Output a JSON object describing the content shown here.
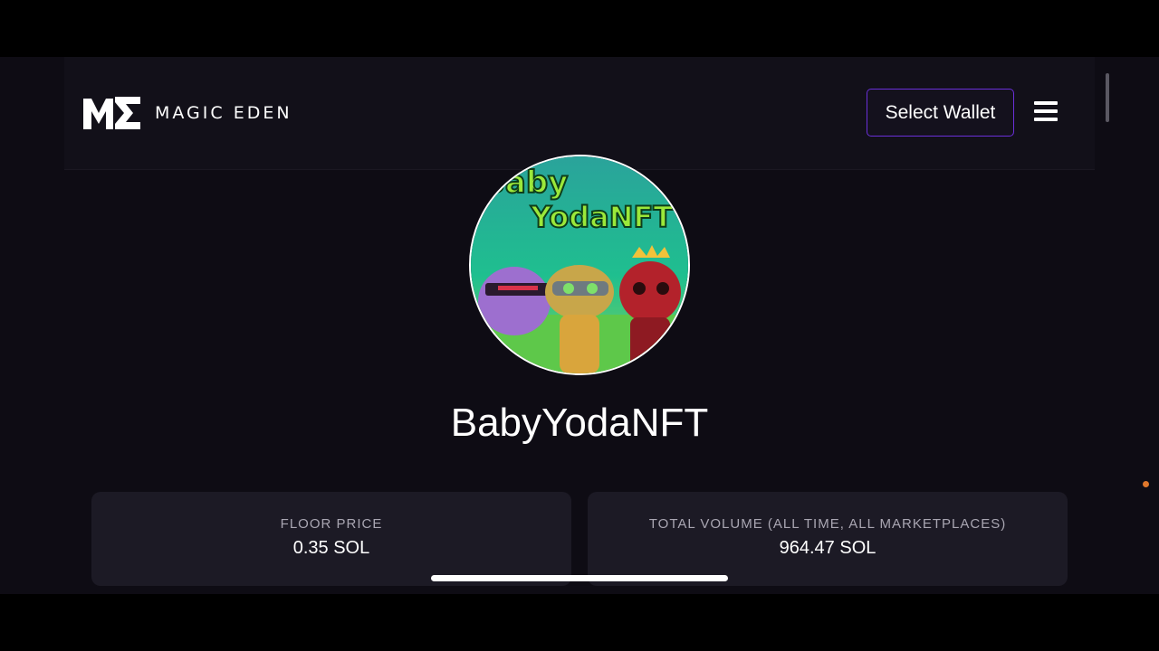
{
  "header": {
    "logo_text": "MAGIC EDEN",
    "wallet_button": "Select Wallet"
  },
  "collection": {
    "name": "BabyYodaNFT",
    "avatar_text": [
      "Baby",
      "YodaNFT"
    ]
  },
  "stats": [
    {
      "label": "FLOOR PRICE",
      "value": "0.35 SOL"
    },
    {
      "label": "TOTAL VOLUME (ALL TIME, ALL MARKETPLACES)",
      "value": "964.47 SOL"
    }
  ],
  "colors": {
    "accent": "#6a2fd9",
    "background": "#0e0c14",
    "card": "#1c1a25"
  }
}
